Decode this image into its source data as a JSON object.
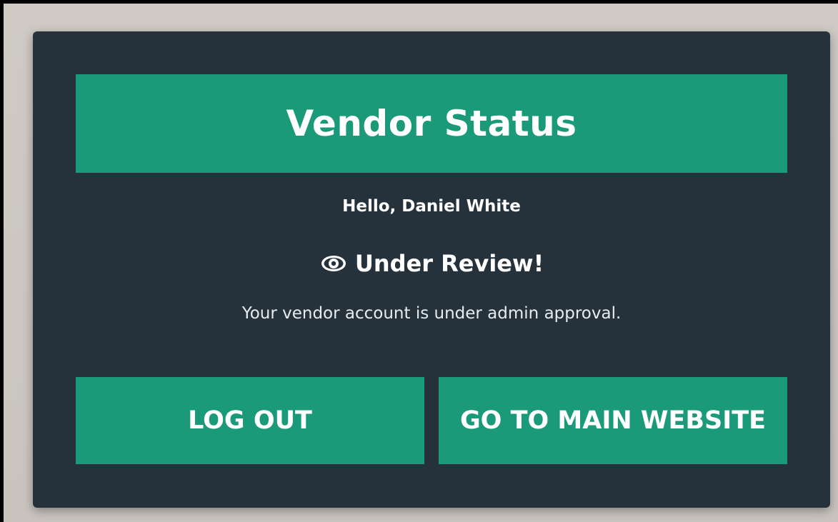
{
  "header": {
    "title": "Vendor Status"
  },
  "greeting": "Hello, Daniel White",
  "status": {
    "icon": "eye-icon",
    "label": "Under Review!",
    "message": "Your vendor account is under admin approval."
  },
  "actions": {
    "logout_label": "LOG OUT",
    "main_site_label": "GO TO MAIN WEBSITE"
  },
  "colors": {
    "card_background": "#25313b",
    "accent": "#1a9a78",
    "page_background": "#cdc8c2"
  }
}
